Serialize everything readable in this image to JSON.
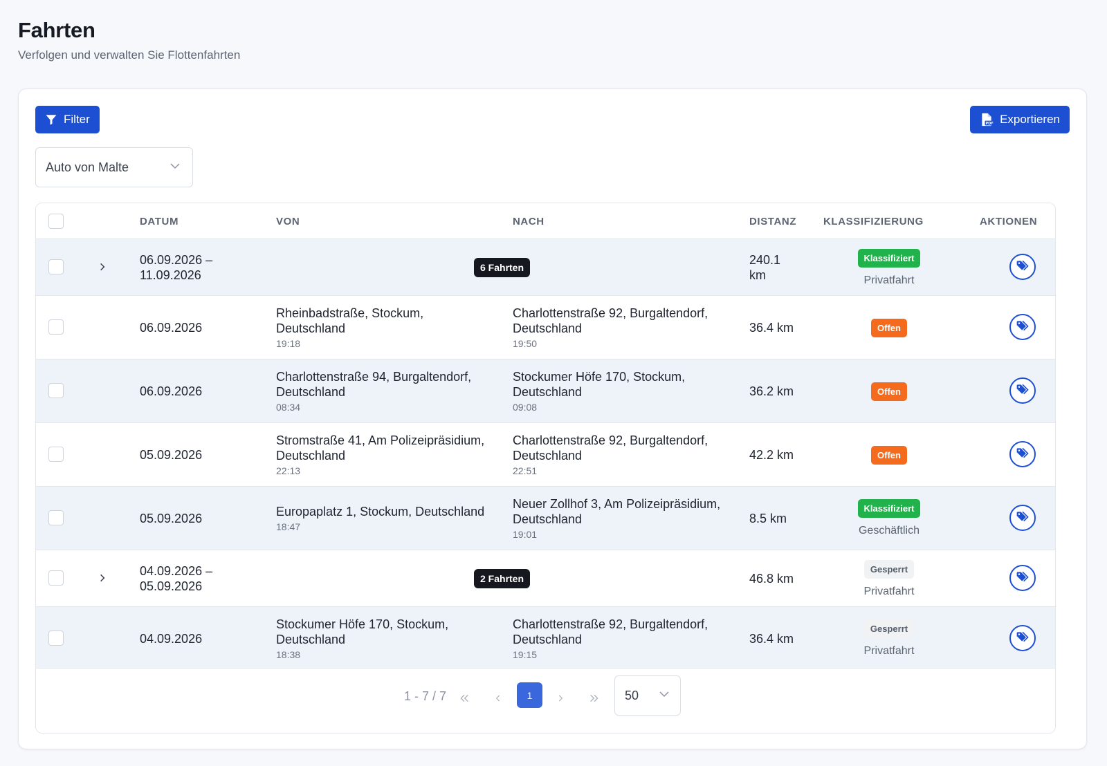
{
  "header": {
    "title": "Fahrten",
    "subtitle": "Verfolgen und verwalten Sie Flottenfahrten"
  },
  "toolbar": {
    "filter_label": "Filter",
    "export_label": "Exportieren"
  },
  "vehicle_select": {
    "value": "Auto von Malte"
  },
  "table": {
    "columns": [
      "DATUM",
      "VON",
      "NACH",
      "DISTANZ",
      "KLASSIFIZIERUNG",
      "AKTIONEN"
    ],
    "rows": [
      {
        "date_line1": "06.09.2026 –",
        "date_line2": "11.09.2026",
        "group_badge": "6 Fahrten",
        "distance_line1": "240.1",
        "distance_line2": "km",
        "status": "Klassifiziert",
        "sub_status": "Privatfahrt"
      },
      {
        "date": "06.09.2026",
        "from_line1": "Rheinbadstraße, Stockum,",
        "from_line2": "Deutschland",
        "from_time": "19:18",
        "to_line1": "Charlottenstraße 92, Burgaltendorf,",
        "to_line2": "Deutschland",
        "to_time": "19:50",
        "distance": "36.4 km",
        "status": "Offen"
      },
      {
        "date": "06.09.2026",
        "from_line1": "Charlottenstraße 94, Burgaltendorf,",
        "from_line2": "Deutschland",
        "from_time": "08:34",
        "to_line1": "Stockumer Höfe 170, Stockum,",
        "to_line2": "Deutschland",
        "to_time": "09:08",
        "distance": "36.2 km",
        "status": "Offen"
      },
      {
        "date": "05.09.2026",
        "from_line1": "Stromstraße 41, Am Polizeipräsidium,",
        "from_line2": "Deutschland",
        "from_time": "22:13",
        "to_line1": "Charlottenstraße 92, Burgaltendorf,",
        "to_line2": "Deutschland",
        "to_time": "22:51",
        "distance": "42.2 km",
        "status": "Offen"
      },
      {
        "date": "05.09.2026",
        "from_line1": "Europaplatz 1, Stockum, Deutschland",
        "from_time": "18:47",
        "to_line1": "Neuer Zollhof 3, Am Polizeipräsidium,",
        "to_line2": "Deutschland",
        "to_time": "19:01",
        "distance": "8.5 km",
        "status": "Klassifiziert",
        "sub_status": "Geschäftlich"
      },
      {
        "date_line1": "04.09.2026 –",
        "date_line2": "05.09.2026",
        "group_badge": "2 Fahrten",
        "distance": "46.8 km",
        "status": "Gesperrt",
        "sub_status": "Privatfahrt"
      },
      {
        "date": "04.09.2026",
        "from_line1": "Stockumer Höfe 170, Stockum,",
        "from_line2": "Deutschland",
        "from_time": "18:38",
        "to_line1": "Charlottenstraße 92, Burgaltendorf,",
        "to_line2": "Deutschland",
        "to_time": "19:15",
        "distance": "36.4 km",
        "status": "Gesperrt",
        "sub_status": "Privatfahrt"
      }
    ]
  },
  "pagination": {
    "range": "1 - 7 / 7",
    "current_page": "1",
    "page_size": "50"
  },
  "colors": {
    "primary": "#1c4fd1",
    "classified": "#22b24c",
    "open": "#f56b1d",
    "locked_bg": "#f1f2f4",
    "row_shade": "#eef2f9"
  },
  "icons": [
    "filter-icon",
    "pdf-file-icon",
    "chevron-down-icon",
    "chevron-right-icon",
    "tags-icon",
    "double-chevron-left-icon",
    "chevron-left-icon",
    "double-chevron-right-icon"
  ]
}
